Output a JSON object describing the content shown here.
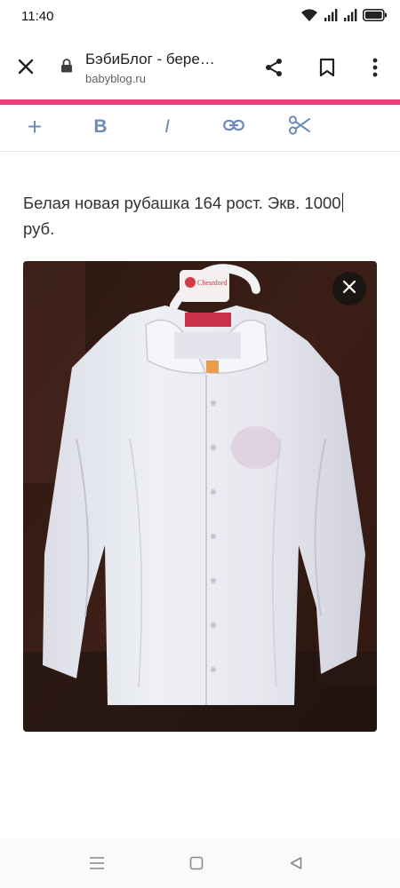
{
  "status_bar": {
    "time": "11:40",
    "icons": [
      "wifi-icon",
      "signal-icon",
      "signal-icon",
      "battery-icon"
    ]
  },
  "browser": {
    "page_title": "БэбиБлог - бере…",
    "url": "babyblog.ru",
    "icons": [
      "close-icon",
      "lock-icon",
      "share-icon",
      "bookmark-icon",
      "more-icon"
    ]
  },
  "accent_color": "#e8417a",
  "editor_toolbar": {
    "buttons": [
      {
        "name": "add",
        "label": "+"
      },
      {
        "name": "bold",
        "label": "B"
      },
      {
        "name": "italic",
        "label": "I"
      },
      {
        "name": "link",
        "icon": "link-icon"
      },
      {
        "name": "cut",
        "icon": "scissors-icon"
      }
    ],
    "color": "#6c8bb6"
  },
  "post": {
    "text": "Белая новая рубашка 164 рост. Экв. 1000 руб.",
    "photo_label": "Chesnford"
  },
  "nav_bar": {
    "icons": [
      "menu-icon",
      "home-icon",
      "back-icon"
    ]
  }
}
